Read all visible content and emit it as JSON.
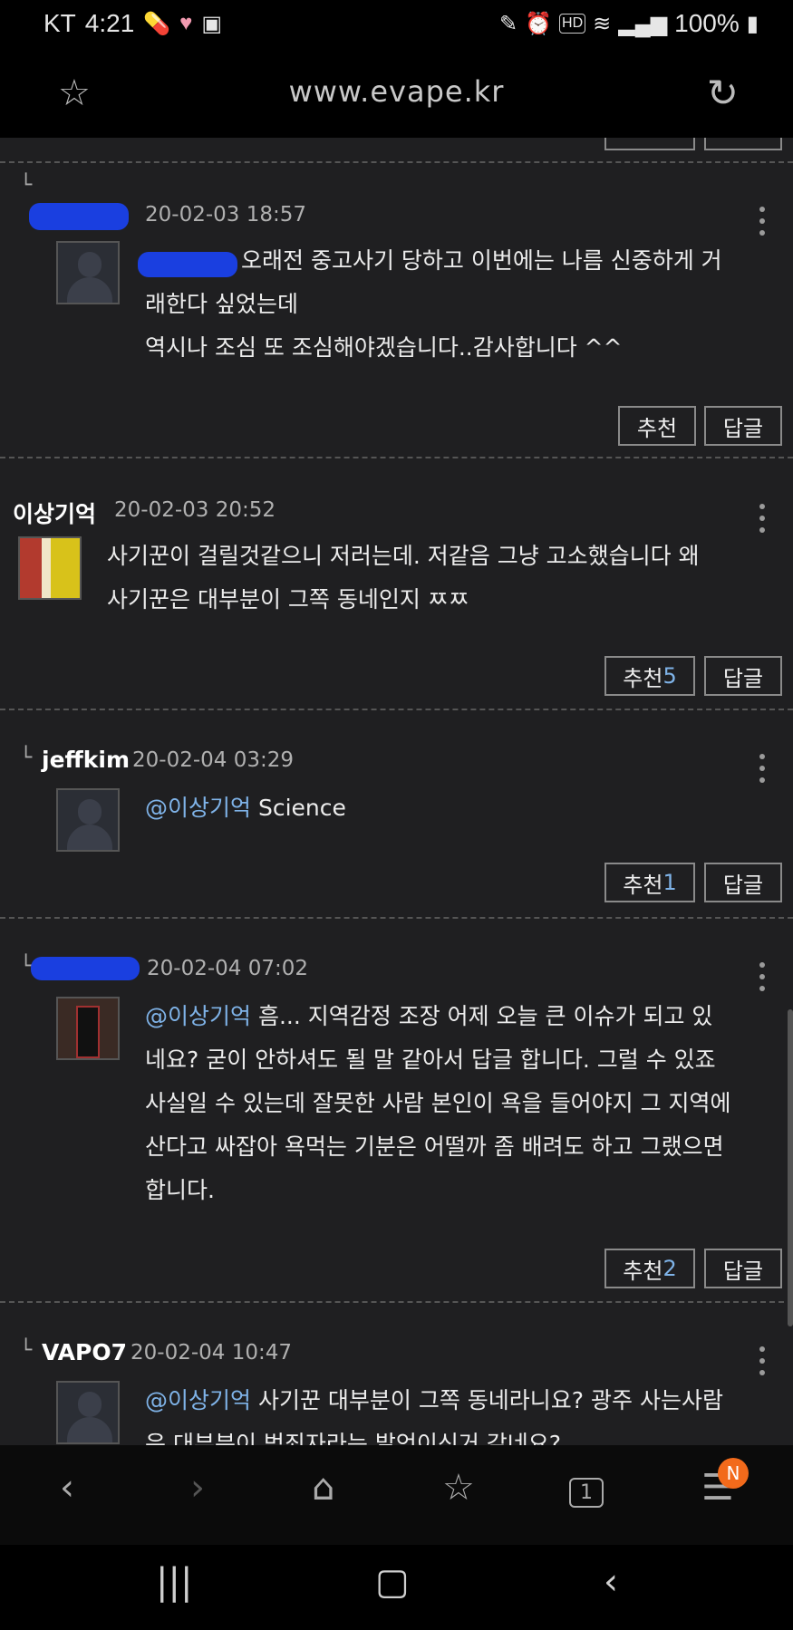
{
  "status": {
    "carrier": "KT",
    "time": "4:21",
    "battery": "100%",
    "left_icons": [
      "pill-icon",
      "heart-icon",
      "s-icon"
    ],
    "right_icons": [
      "pen-icon",
      "alarm-icon",
      "hd-icon",
      "wifi-icon",
      "signal-icon",
      "battery-icon"
    ]
  },
  "browser": {
    "url": "www.evape.kr"
  },
  "comments": [
    {
      "author": "",
      "date": "20-02-03 18:57",
      "mention": "",
      "lines": [
        "오래전 중고사기 당하고 이번에는 나름 신중하게 거",
        "래한다 싶었는데",
        "역시나 조심 또 조심해야겠습니다..감사합니다 ^^"
      ],
      "recommend": "추천",
      "reply": "답글"
    },
    {
      "author": "이상기억",
      "date": "20-02-03 20:52",
      "lines": [
        "사기꾼이 걸릴것같으니 저러는데.  저같음 그냥 고소했습니다 왜",
        "사기꾼은 대부분이 그쪽 동네인지 ㅉㅉ"
      ],
      "recommend": "추천",
      "recommend_count": "5",
      "reply": "답글"
    },
    {
      "author": "jeffkim",
      "date": "20-02-04 03:29",
      "mention": "@이상기억",
      "lines": [
        "Science"
      ],
      "recommend": "추천",
      "recommend_count": "1",
      "reply": "답글"
    },
    {
      "author": "",
      "date": "20-02-04 07:02",
      "mention": "@이상기억",
      "lines": [
        "흠... 지역감정 조장 어제 오늘 큰 이슈가 되고 있",
        "네요? 굳이 안하셔도 될 말 같아서 답글 합니다. 그럴 수 있죠",
        "사실일 수 있는데 잘못한 사람 본인이 욕을 들어야지 그 지역에",
        "산다고 싸잡아 욕먹는 기분은 어떨까 좀 배려도 하고 그랬으면",
        "합니다."
      ],
      "recommend": "추천",
      "recommend_count": "2",
      "reply": "답글"
    },
    {
      "author": "VAPO7",
      "date": "20-02-04 10:47",
      "mention": "@이상기억",
      "lines": [
        "사기꾼 대부분이 그쪽 동네라니요? 광주 사는사람",
        "은 대부분이 범죄자라는 발언이신거 같네요?"
      ]
    }
  ],
  "reply_marker": "└",
  "bottom_nav": {
    "tabs_count": "1",
    "badge": "N",
    "icons": [
      "back-icon",
      "forward-icon",
      "home-icon",
      "bookmark-icon",
      "tabs-icon",
      "menu-icon"
    ]
  },
  "system_nav": {
    "icons": [
      "recents-icon",
      "home-button-icon",
      "back-button-icon"
    ]
  }
}
